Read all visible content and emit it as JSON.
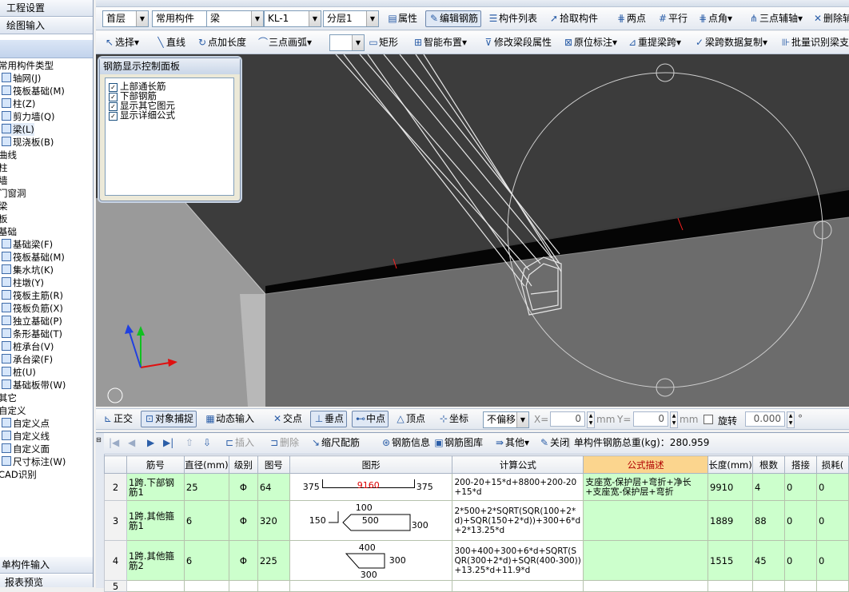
{
  "left_panel": {
    "top_items": [
      "工程设置",
      "绘图输入"
    ],
    "tree": [
      {
        "label": "常用构件类型",
        "indent": 0
      },
      {
        "label": "轴网(J)",
        "indent": 1
      },
      {
        "label": "筏板基础(M)",
        "indent": 1
      },
      {
        "label": "柱(Z)",
        "indent": 1
      },
      {
        "label": "剪力墙(Q)",
        "indent": 1
      },
      {
        "label": "梁(L)",
        "indent": 1,
        "selected": true
      },
      {
        "label": "现浇板(B)",
        "indent": 1
      },
      {
        "label": "曲线",
        "indent": 0
      },
      {
        "label": "柱",
        "indent": 0
      },
      {
        "label": "墙",
        "indent": 0
      },
      {
        "label": "门窗洞",
        "indent": 0
      },
      {
        "label": "梁",
        "indent": 0
      },
      {
        "label": "板",
        "indent": 0
      },
      {
        "label": "基础",
        "indent": 0
      },
      {
        "label": "基础梁(F)",
        "indent": 1
      },
      {
        "label": "筏板基础(M)",
        "indent": 1
      },
      {
        "label": "集水坑(K)",
        "indent": 1
      },
      {
        "label": "柱墩(Y)",
        "indent": 1
      },
      {
        "label": "筏板主筋(R)",
        "indent": 1
      },
      {
        "label": "筏板负筋(X)",
        "indent": 1
      },
      {
        "label": "独立基础(P)",
        "indent": 1
      },
      {
        "label": "条形基础(T)",
        "indent": 1
      },
      {
        "label": "桩承台(V)",
        "indent": 1
      },
      {
        "label": "承台梁(F)",
        "indent": 1
      },
      {
        "label": "桩(U)",
        "indent": 1
      },
      {
        "label": "基础板带(W)",
        "indent": 1
      },
      {
        "label": "其它",
        "indent": 0
      },
      {
        "label": "自定义",
        "indent": 0
      },
      {
        "label": "自定义点",
        "indent": 1
      },
      {
        "label": "自定义线",
        "indent": 1
      },
      {
        "label": "自定义面",
        "indent": 1
      },
      {
        "label": "尺寸标注(W)",
        "indent": 1
      },
      {
        "label": "CAD识别",
        "indent": 0
      }
    ],
    "bottom_items": [
      "单构件输入",
      "报表预览"
    ]
  },
  "toolbar1": {
    "floor": "首层",
    "category": "常用构件",
    "element_type": "梁",
    "element": "KL-1",
    "layer": "分层1",
    "buttons": [
      "属性",
      "编辑钢筋",
      "构件列表",
      "拾取构件",
      "两点",
      "平行",
      "点角",
      "三点辅轴",
      "删除辅"
    ]
  },
  "toolbar2": {
    "buttons": [
      "选择",
      "直线",
      "点加长度",
      "三点画弧",
      "矩形",
      "智能布置",
      "修改梁段属性",
      "原位标注",
      "重提梁跨",
      "梁跨数据复制",
      "批量识别梁支"
    ]
  },
  "display_panel": {
    "title": "钢筋显示控制面板",
    "options": [
      {
        "label": "上部通长筋",
        "checked": true
      },
      {
        "label": "下部钢筋",
        "checked": true
      },
      {
        "label": "显示其它图元",
        "checked": true
      },
      {
        "label": "显示详细公式",
        "checked": true
      }
    ]
  },
  "snap_bar": {
    "buttons": [
      "正交",
      "对象捕捉",
      "动态输入",
      "交点",
      "垂点",
      "中点",
      "顶点",
      "坐标"
    ],
    "offset_mode": "不偏移",
    "x_label": "X=",
    "x_value": "0",
    "y_label": "Y=",
    "y_value": "0",
    "unit": "mm",
    "rotate_label": "旋转",
    "rotate_value": "0.000",
    "degree": "°"
  },
  "rebar_toolbar": {
    "buttons": [
      "插入",
      "删除",
      "缩尺配筋",
      "钢筋信息",
      "钢筋图库",
      "其他",
      "关闭"
    ],
    "total_label": "单构件钢筋总重(kg)：280.959"
  },
  "rebar_table": {
    "headers": [
      "",
      "筋号",
      "直径(mm)",
      "级别",
      "图号",
      "图形",
      "计算公式",
      "公式描述",
      "长度(mm)",
      "根数",
      "搭接",
      "损耗("
    ],
    "rows": [
      {
        "index": "2",
        "name": "1跨.下部钢筋1",
        "diameter": "25",
        "grade": "Φ",
        "fig": "64",
        "shape": {
          "left": "375",
          "middle": "9160",
          "right": "375"
        },
        "formula": "200-20+15*d+8800+200-20+15*d",
        "desc": "支座宽-保护层+弯折+净长+支座宽-保护层+弯折",
        "length": "9910",
        "count": "4",
        "lap": "0",
        "loss": "0"
      },
      {
        "index": "3",
        "name": "1跨.其他箍筋1",
        "diameter": "6",
        "grade": "Φ",
        "fig": "320",
        "shape": {
          "top": "100",
          "left": "150",
          "middle": "500",
          "right": "300"
        },
        "formula": "2*500+2*SQRT(SQR(100+2*d)+SQR(150+2*d))+300+6*d+2*13.25*d",
        "desc": "",
        "length": "1889",
        "count": "88",
        "lap": "0",
        "loss": "0"
      },
      {
        "index": "4",
        "name": "1跨.其他箍筋2",
        "diameter": "6",
        "grade": "Φ",
        "fig": "225",
        "shape": {
          "top": "400",
          "right": "300",
          "bottom": "300"
        },
        "formula": "300+400+300+6*d+SQRT(SQR(300+2*d)+SQR(400-300))+13.25*d+11.9*d",
        "desc": "",
        "length": "1515",
        "count": "45",
        "lap": "0",
        "loss": "0"
      },
      {
        "index": "5",
        "name": "",
        "diameter": "",
        "grade": "",
        "fig": "",
        "shape": {},
        "formula": "",
        "desc": "",
        "length": "",
        "count": "",
        "lap": "",
        "loss": ""
      }
    ]
  }
}
